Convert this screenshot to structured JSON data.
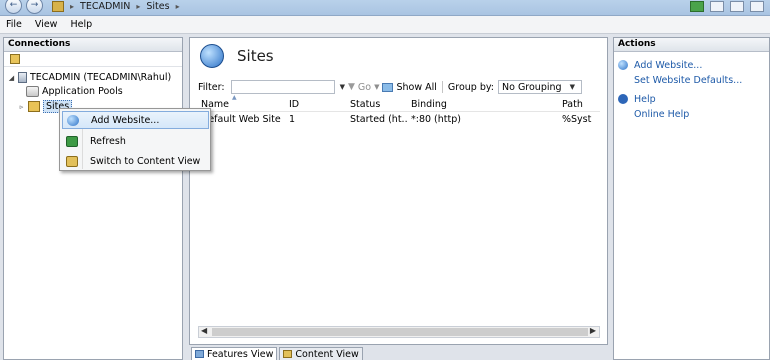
{
  "breadcrumb": {
    "items": [
      "TECADMIN",
      "Sites"
    ]
  },
  "menu": [
    "File",
    "View",
    "Help"
  ],
  "connections": {
    "header": "Connections",
    "tree": {
      "server": "TECADMIN (TECADMIN\\Rahul)",
      "app_pools": "Application Pools",
      "sites": "Sites"
    }
  },
  "context_menu": {
    "items": [
      "Add Website...",
      "Refresh",
      "Switch to Content View"
    ],
    "highlighted_index": 0
  },
  "main": {
    "title": "Sites",
    "filter": {
      "label": "Filter:",
      "value": "",
      "go_label": "Go",
      "show_all_label": "Show All",
      "group_by_label": "Group by:",
      "group_by_value": "No Grouping"
    },
    "columns": [
      "Name",
      "ID",
      "Status",
      "Binding",
      "Path"
    ],
    "rows": [
      [
        "Default Web Site",
        "1",
        "Started (ht...",
        "*:80 (http)",
        "%Syst"
      ]
    ]
  },
  "view_tabs": [
    "Features View",
    "Content View"
  ],
  "actions": {
    "header": "Actions",
    "links": [
      "Add Website...",
      "Set Website Defaults...",
      "Help",
      "Online Help"
    ]
  },
  "colors": {
    "link": "#1e5aa8",
    "selection": "#cfe3f7",
    "menu_highlight_border": "#84acdd"
  },
  "icons": [
    "back-arrow-icon",
    "forward-arrow-icon",
    "globe-icon",
    "server-icon",
    "folder-icon",
    "refresh-icon",
    "help-icon"
  ]
}
